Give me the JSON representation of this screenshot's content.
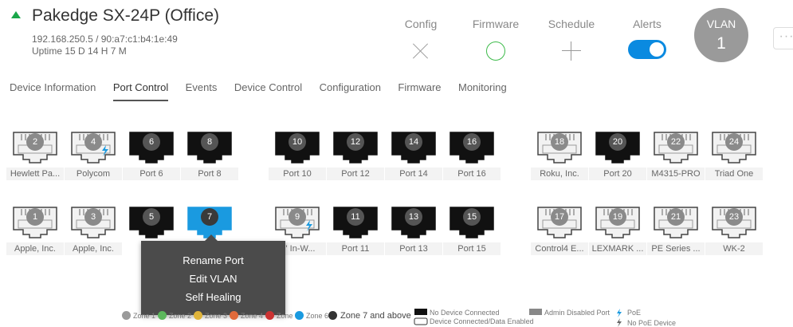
{
  "device": {
    "name": "Pakedge SX-24P (Office)",
    "address": "192.168.250.5 / 90:a7:c1:b4:1e:49",
    "uptime": "Uptime 15 D 14 H 7 M"
  },
  "header": {
    "config_label": "Config",
    "firmware_label": "Firmware",
    "schedule_label": "Schedule",
    "alerts_label": "Alerts",
    "alerts_enabled": true,
    "vlan_label": "VLAN",
    "vlan_number": "1",
    "more_label": "···"
  },
  "tabs": [
    {
      "label": "Device Information",
      "active": false
    },
    {
      "label": "Port Control",
      "active": true
    },
    {
      "label": "Events",
      "active": false
    },
    {
      "label": "Device Control",
      "active": false
    },
    {
      "label": "Configuration",
      "active": false
    },
    {
      "label": "Firmware",
      "active": false
    },
    {
      "label": "Monitoring",
      "active": false
    }
  ],
  "ports_top": [
    {
      "number": "2",
      "label": "Hewlett Pa...",
      "connected": true,
      "poe": false
    },
    {
      "number": "4",
      "label": "Polycom",
      "connected": true,
      "poe": true
    },
    {
      "number": "6",
      "label": "Port 6",
      "connected": false,
      "poe": false
    },
    {
      "number": "8",
      "label": "Port 8",
      "connected": false,
      "poe": false
    },
    {
      "number": "10",
      "label": "Port 10",
      "connected": false,
      "poe": false
    },
    {
      "number": "12",
      "label": "Port 12",
      "connected": false,
      "poe": false
    },
    {
      "number": "14",
      "label": "Port 14",
      "connected": false,
      "poe": false
    },
    {
      "number": "16",
      "label": "Port 16",
      "connected": false,
      "poe": false
    },
    {
      "number": "18",
      "label": "Roku, Inc.",
      "connected": true,
      "poe": false
    },
    {
      "number": "20",
      "label": "Port 20",
      "connected": false,
      "poe": false
    },
    {
      "number": "22",
      "label": "M4315-PRO",
      "connected": true,
      "poe": false
    },
    {
      "number": "24",
      "label": "Triad One",
      "connected": true,
      "poe": false
    }
  ],
  "ports_bottom": [
    {
      "number": "1",
      "label": "Apple, Inc.",
      "connected": true,
      "poe": false
    },
    {
      "number": "3",
      "label": "Apple, Inc.",
      "connected": true,
      "poe": false
    },
    {
      "number": "5",
      "label": "",
      "connected": false,
      "poe": false
    },
    {
      "number": "7",
      "label": "",
      "connected": false,
      "poe": false,
      "selected": true
    },
    {
      "number": "9",
      "label": "7\" In-W...",
      "connected": true,
      "poe": true
    },
    {
      "number": "11",
      "label": "Port 11",
      "connected": false,
      "poe": false
    },
    {
      "number": "13",
      "label": "Port 13",
      "connected": false,
      "poe": false
    },
    {
      "number": "15",
      "label": "Port 15",
      "connected": false,
      "poe": false
    },
    {
      "number": "17",
      "label": "Control4 E...",
      "connected": true,
      "poe": false
    },
    {
      "number": "19",
      "label": "LEXMARK ...",
      "connected": true,
      "poe": false
    },
    {
      "number": "21",
      "label": "PE Series ...",
      "connected": true,
      "poe": false
    },
    {
      "number": "23",
      "label": "WK-2",
      "connected": true,
      "poe": false
    }
  ],
  "popup_menu": {
    "items": [
      "Rename Port",
      "Edit VLAN",
      "Self Healing"
    ]
  },
  "legend": {
    "zones": [
      {
        "label": "Zone 1",
        "color": "#9a9a9a"
      },
      {
        "label": "Zone 2",
        "color": "#5cb85c"
      },
      {
        "label": "Zone 3",
        "color": "#e0b43a"
      },
      {
        "label": "Zone 4",
        "color": "#e06a3a"
      },
      {
        "label": "Zone 5",
        "color": "#cc3333"
      },
      {
        "label": "Zone 6",
        "color": "#1a9ae0"
      }
    ],
    "zone7_label": "Zone 7 and above",
    "no_device_label": "No Device Connected",
    "device_connected_label": "Device Connected/Data Enabled",
    "admin_disabled_label": "Admin Disabled Port",
    "poe_label": "PoE",
    "no_poe_label": "No PoE Device"
  },
  "colors": {
    "selected_port": "#1a9ae0",
    "connected_port_fill": "#f2f2f2",
    "empty_port_fill": "#111111",
    "status_green": "#1aa64a",
    "alerts_toggle": "#0a8ae0",
    "poe_blue": "#1a9ae0"
  }
}
